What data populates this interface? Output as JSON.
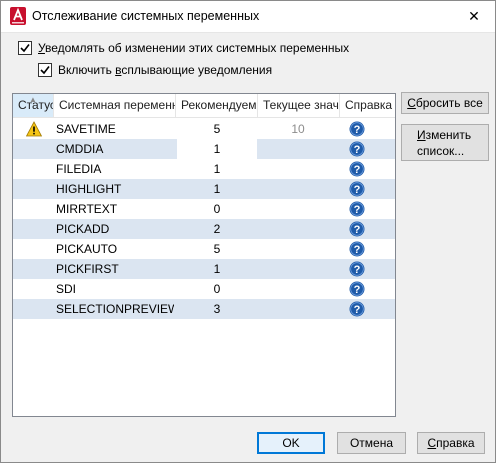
{
  "window": {
    "title": "Отслеживание системных переменных",
    "close_glyph": "✕"
  },
  "options": {
    "notify_label_prefix": "",
    "notify_label_u": "У",
    "notify_label_rest": "ведомлять об изменении этих системных переменных",
    "notify_checked": true,
    "balloon_label_prefix": "Включить ",
    "balloon_label_u": "в",
    "balloon_label_rest": "сплывающие уведомления",
    "balloon_checked": true
  },
  "table": {
    "columns": [
      {
        "label": "Статус"
      },
      {
        "label": "Системная переменная"
      },
      {
        "label": "Рекомендуемое"
      },
      {
        "label": "Текущее значение"
      },
      {
        "label": "Справка"
      }
    ],
    "rows": [
      {
        "status": "warning-icon",
        "name": "SAVETIME",
        "recommended": "5",
        "current": "10"
      },
      {
        "status": "",
        "name": "CMDDIA",
        "recommended": "1",
        "current": ""
      },
      {
        "status": "",
        "name": "FILEDIA",
        "recommended": "1",
        "current": ""
      },
      {
        "status": "",
        "name": "HIGHLIGHT",
        "recommended": "1",
        "current": ""
      },
      {
        "status": "",
        "name": "MIRRTEXT",
        "recommended": "0",
        "current": ""
      },
      {
        "status": "",
        "name": "PICKADD",
        "recommended": "2",
        "current": ""
      },
      {
        "status": "",
        "name": "PICKAUTO",
        "recommended": "5",
        "current": ""
      },
      {
        "status": "",
        "name": "PICKFIRST",
        "recommended": "1",
        "current": ""
      },
      {
        "status": "",
        "name": "SDI",
        "recommended": "0",
        "current": ""
      },
      {
        "status": "",
        "name": "SELECTIONPREVIEW",
        "recommended": "3",
        "current": ""
      }
    ],
    "help_icon": "help-icon"
  },
  "side_buttons": {
    "reset_all_u": "С",
    "reset_all_rest": "бросить все",
    "edit_list_line1_u": "И",
    "edit_list_line1_rest": "зменить",
    "edit_list_line2": "список..."
  },
  "footer": {
    "ok": "OK",
    "cancel": "Отмена",
    "help_u": "С",
    "help_rest": "правка"
  },
  "colors": {
    "accent": "#0078d7",
    "row_alt": "#dbe5f1",
    "help_icon": "#1e5aa8",
    "warning": "#f5c518",
    "app_icon": "#c8102e"
  }
}
